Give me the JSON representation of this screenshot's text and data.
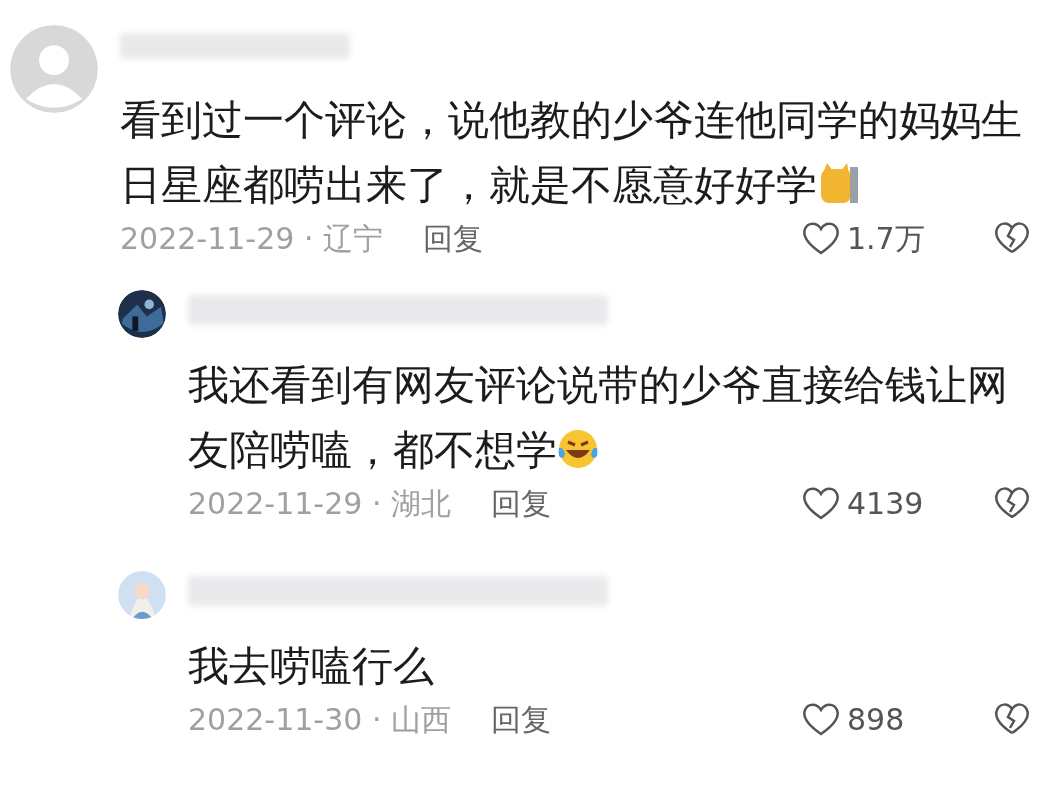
{
  "comments": [
    {
      "avatar": {
        "kind": "default"
      },
      "text": "看到过一个评论，说他教的少爷连他同学的妈妈生日星座都唠出来了，就是不愿意好好学",
      "emoji": {
        "kind": "cat"
      },
      "meta": "2022-11-29 · 辽宁",
      "reply": "回复",
      "likes": "1.7万",
      "children": [
        {
          "avatar": {
            "kind": "dark"
          },
          "text": "我还看到有网友评论说带的少爷直接给钱让网友陪唠嗑，都不想学",
          "emoji": {
            "kind": "laugh"
          },
          "meta": "2022-11-29 · 湖北",
          "reply": "回复",
          "likes": "4139"
        },
        {
          "avatar": {
            "kind": "light"
          },
          "text": "我去唠嗑行么",
          "meta": "2022-11-30 · 山西",
          "reply": "回复",
          "likes": "898"
        }
      ]
    }
  ]
}
